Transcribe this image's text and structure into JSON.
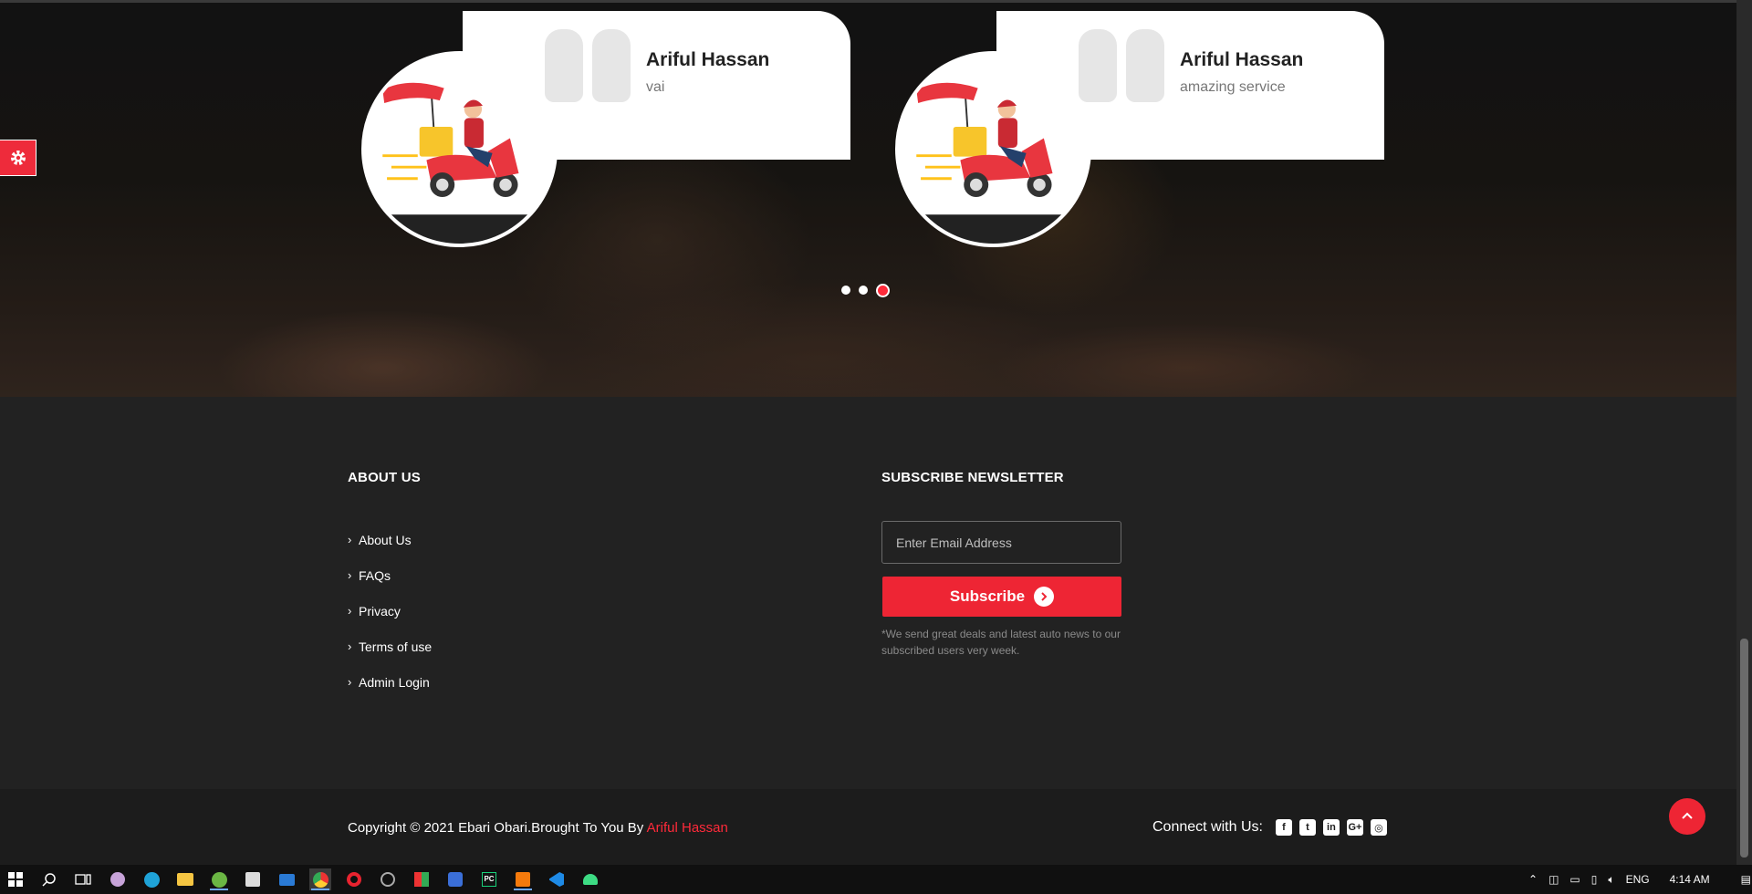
{
  "hero": {
    "testimonials": [
      {
        "name": "Ariful Hassan",
        "message": "vai"
      },
      {
        "name": "Ariful Hassan",
        "message": "amazing service"
      }
    ],
    "carousel": {
      "count": 3,
      "active_index": 2
    }
  },
  "settings_panel": {
    "icon": "gear-icon",
    "color": "#ee2b3b"
  },
  "footer": {
    "about": {
      "title": "ABOUT US",
      "links": [
        "About Us",
        "FAQs",
        "Privacy",
        "Terms of use",
        "Admin Login"
      ]
    },
    "newsletter": {
      "title": "SUBSCRIBE NEWSLETTER",
      "email_placeholder": "Enter Email Address",
      "button_label": "Subscribe",
      "note": "*We send great deals and latest auto news to our subscribed users very week."
    },
    "bottom": {
      "copyright": "Copyright © 2021 Ebari Obari.Brought To You By ",
      "author": "Ariful Hassan",
      "connect_label": "Connect with Us:",
      "social_icons": [
        "facebook-icon",
        "twitter-icon",
        "linkedin-icon",
        "google-plus-icon",
        "instagram-icon"
      ]
    }
  },
  "colors": {
    "accent": "#ee2534",
    "footer_bg": "#222222",
    "bottom_bg": "#1c1c1c"
  },
  "taskbar": {
    "language": "ENG",
    "time": "4:14 AM",
    "apps": [
      "windows-start-icon",
      "search-icon",
      "task-view-icon",
      "app-icon",
      "edge-icon",
      "file-explorer-icon",
      "utorrent-icon",
      "store-icon",
      "mail-icon",
      "chrome-icon",
      "opera-icon",
      "app-icon",
      "app-icon",
      "app-icon",
      "pycharm-icon",
      "xampp-icon",
      "vscode-icon",
      "android-studio-icon"
    ]
  }
}
